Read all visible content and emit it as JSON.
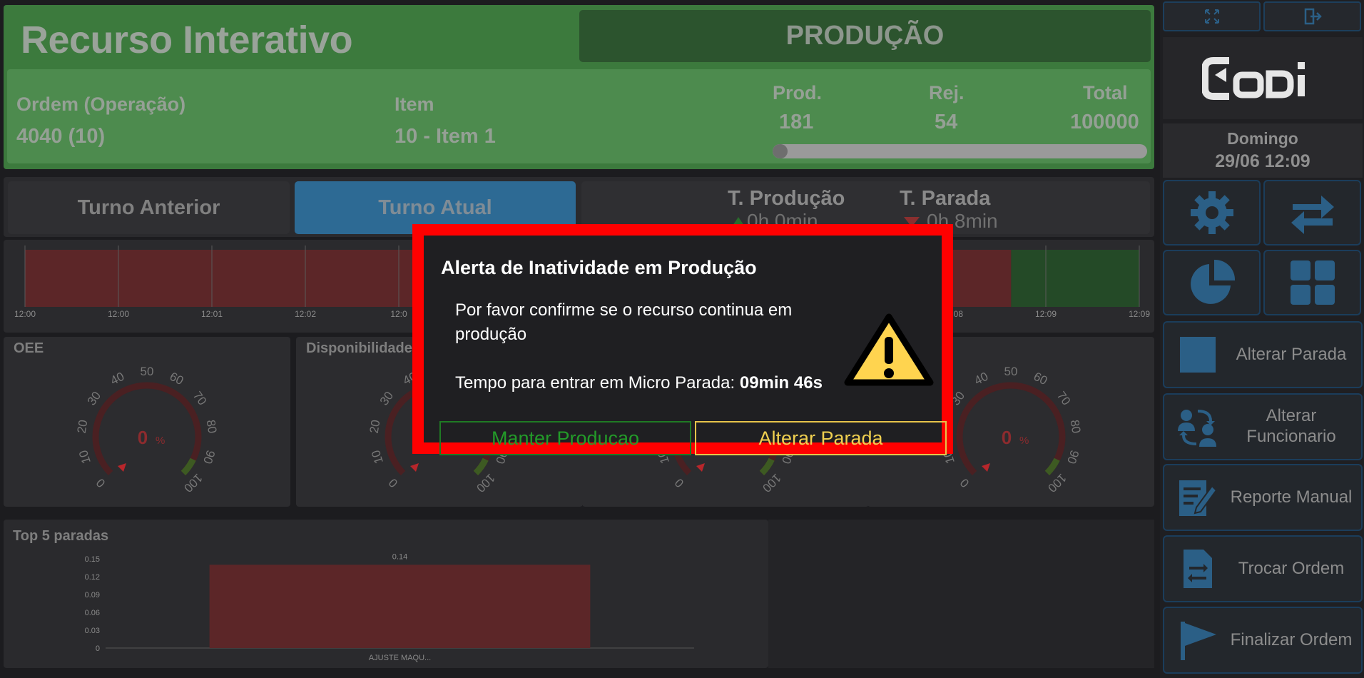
{
  "colors": {
    "header_green": "#3c7a3d",
    "accent_blue": "#2d6a94",
    "stop_red": "#5c2628",
    "run_green": "#244a27",
    "alert_red": "#ff0000",
    "warn_yellow": "#ffd44f"
  },
  "header": {
    "title": "Recurso Interativo",
    "status": "PRODUÇÃO",
    "order_label": "Ordem (Operação)",
    "order_value": "4040 (10)",
    "item_label": "Item",
    "item_value": "10 - Item 1",
    "prod_label": "Prod.",
    "prod_value": "181",
    "rej_label": "Rej.",
    "rej_value": "54",
    "total_label": "Total",
    "total_value": "100000",
    "progress_fraction": 0.002
  },
  "shift": {
    "previous_tab": "Turno Anterior",
    "current_tab": "Turno Atual",
    "prod_time_label": "T. Produção",
    "prod_time_value": "0h 0min",
    "stop_time_label": "T. Parada",
    "stop_time_value": "0h 8min"
  },
  "timeline": {
    "ticks": [
      "12:00",
      "12:00",
      "12:01",
      "12:02",
      "12:0",
      "12:08",
      "12:09",
      "12:09"
    ],
    "stop_until_fraction": 0.885
  },
  "gauges": [
    {
      "title": "OEE",
      "value": "0",
      "unit": "%"
    },
    {
      "title": "Disponibilidade",
      "value": "0",
      "unit": "%"
    },
    {
      "title": "",
      "value": "0",
      "unit": "%"
    },
    {
      "title": "",
      "value": "0",
      "unit": "%"
    }
  ],
  "gauge_scale": [
    "0",
    "10",
    "20",
    "30",
    "40",
    "50",
    "60",
    "70",
    "80",
    "90",
    "100"
  ],
  "top5": {
    "title": "Top 5 paradas",
    "chart_data": {
      "type": "bar",
      "categories": [
        "AJUSTE MAQU..."
      ],
      "values": [
        0.14
      ],
      "data_labels": [
        "0.14"
      ],
      "y_ticks": [
        "0",
        "0.03",
        "0.06",
        "0.09",
        "0.12",
        "0.15"
      ],
      "ylim": [
        0,
        0.15
      ]
    }
  },
  "sidebar": {
    "logo": "Codi",
    "day": "Domingo",
    "datetime": "29/06 12:09",
    "actions": [
      {
        "label": "Alterar Parada"
      },
      {
        "label": "Alterar Funcionario"
      },
      {
        "label": "Reporte Manual"
      },
      {
        "label": "Trocar Ordem"
      },
      {
        "label": "Finalizar Ordem"
      }
    ]
  },
  "modal": {
    "title": "Alerta de Inatividade em Produção",
    "message": "Por favor confirme se o recurso continua em produção",
    "countdown_label": "Tempo para entrar em Micro Parada:",
    "countdown_value": "09min 46s",
    "keep_button": "Manter Producao",
    "change_button": "Alterar Parada"
  }
}
